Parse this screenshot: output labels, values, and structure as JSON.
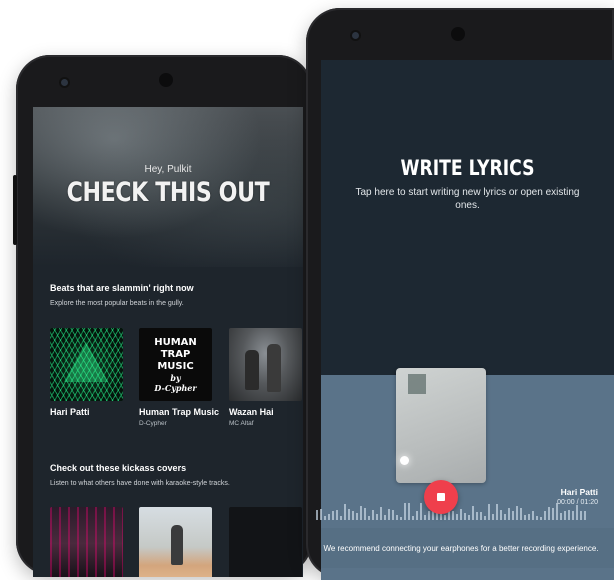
{
  "left_phone": {
    "hero": {
      "greeting": "Hey, Pulkit",
      "headline": "CHECK THIS OUT"
    },
    "section1": {
      "title": "Beats that are slammin' right now",
      "subtitle": "Explore the most popular beats in the gully.",
      "items": [
        {
          "title": "Hari Patti",
          "artist": ""
        },
        {
          "title": "Human Trap Music",
          "artist": "D-Cypher",
          "art_text": [
            "HUMAN",
            "TRAP",
            "MUSIC",
            "by",
            "D-Cypher"
          ]
        },
        {
          "title": "Wazan Hai",
          "artist": "MC Altaf"
        }
      ]
    },
    "section2": {
      "title": "Check out  these kickass covers",
      "subtitle": "Listen to what others have done with karaoke-style tracks."
    }
  },
  "right_phone": {
    "title": "WRITE LYRICS",
    "subtitle": "Tap here to start writing new lyrics or open existing ones.",
    "track_name": "Hari Patti",
    "track_time": "00:00 / 01:20",
    "notice": "We recommend connecting your earphones for a better recording experience.",
    "record_icon": "stop-icon",
    "colors": {
      "record_button": "#ef3f4c",
      "dark_bg": "#1d2832",
      "wave_bg": "#5a7389"
    }
  }
}
